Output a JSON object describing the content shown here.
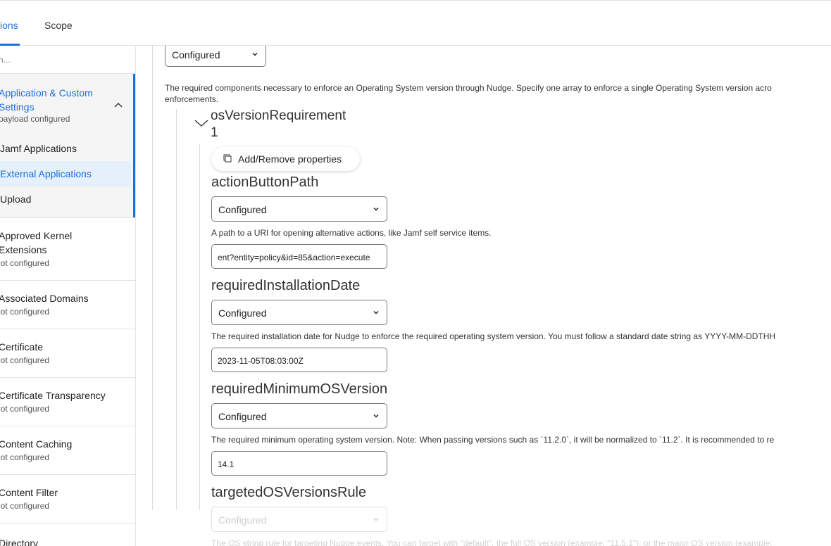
{
  "tabs": [
    {
      "label": "ions",
      "active": true
    },
    {
      "label": "Scope",
      "active": false
    }
  ],
  "sidebar": {
    "search_placeholder": "h...",
    "group": {
      "title": "Application & Custom Settings",
      "subtitle": "payload configured",
      "items": [
        {
          "label": "Jamf Applications",
          "active": false
        },
        {
          "label": "External Applications",
          "active": true
        },
        {
          "label": "Upload",
          "active": false
        }
      ]
    },
    "items": [
      {
        "title": "Approved Kernel Extensions",
        "status": "lot configured"
      },
      {
        "title": "Associated Domains",
        "status": "lot configured"
      },
      {
        "title": "Certificate",
        "status": "lot configured"
      },
      {
        "title": "Certificate Transparency",
        "status": "lot configured"
      },
      {
        "title": "Content Caching",
        "status": "lot configured"
      },
      {
        "title": "Content Filter",
        "status": "lot configured"
      },
      {
        "title": "Directory",
        "status": ""
      }
    ]
  },
  "main": {
    "top_select": "Configured",
    "top_desc_line1": "The required components necessary to enforce an Operating System version through Nudge. Specify one array to enforce a single Operating System version acro",
    "top_desc_line2": "enforcements.",
    "section_title": "osVersionRequirement",
    "section_index": "1",
    "add_remove_label": "Add/Remove properties",
    "properties": {
      "action_button_path": {
        "heading": "actionButtonPath",
        "select": "Configured",
        "description": "A path to a URI for opening alternative actions, like Jamf self service items.",
        "value": "ent?entity=policy&id=85&action=execute"
      },
      "required_installation_date": {
        "heading": "requiredInstallationDate",
        "select": "Configured",
        "description": "The required installation date for Nudge to enforce the required operating system version. You must follow a standard date string as YYYY-MM-DDTHH",
        "value": "2023-11-05T08:03:00Z"
      },
      "required_minimum_os_version": {
        "heading": "requiredMinimumOSVersion",
        "select": "Configured",
        "description": "The required minimum operating system version. Note: When passing versions such as `11.2.0`, it will be normalized to `11.2`. It is recommended to re",
        "value": "14.1"
      },
      "targeted_os_versions_rule": {
        "heading": "targetedOSVersionsRule",
        "select": "Configured",
        "description": "The OS string rule for targeting Nudge events. You can target with \"default\", the full OS version (example: \"11.5.1\"), or the major OS version (example:"
      }
    }
  },
  "colors": {
    "accent": "#1a6fd8",
    "active_bg": "#e6f0fb",
    "group_bg": "#f5f5f5"
  }
}
